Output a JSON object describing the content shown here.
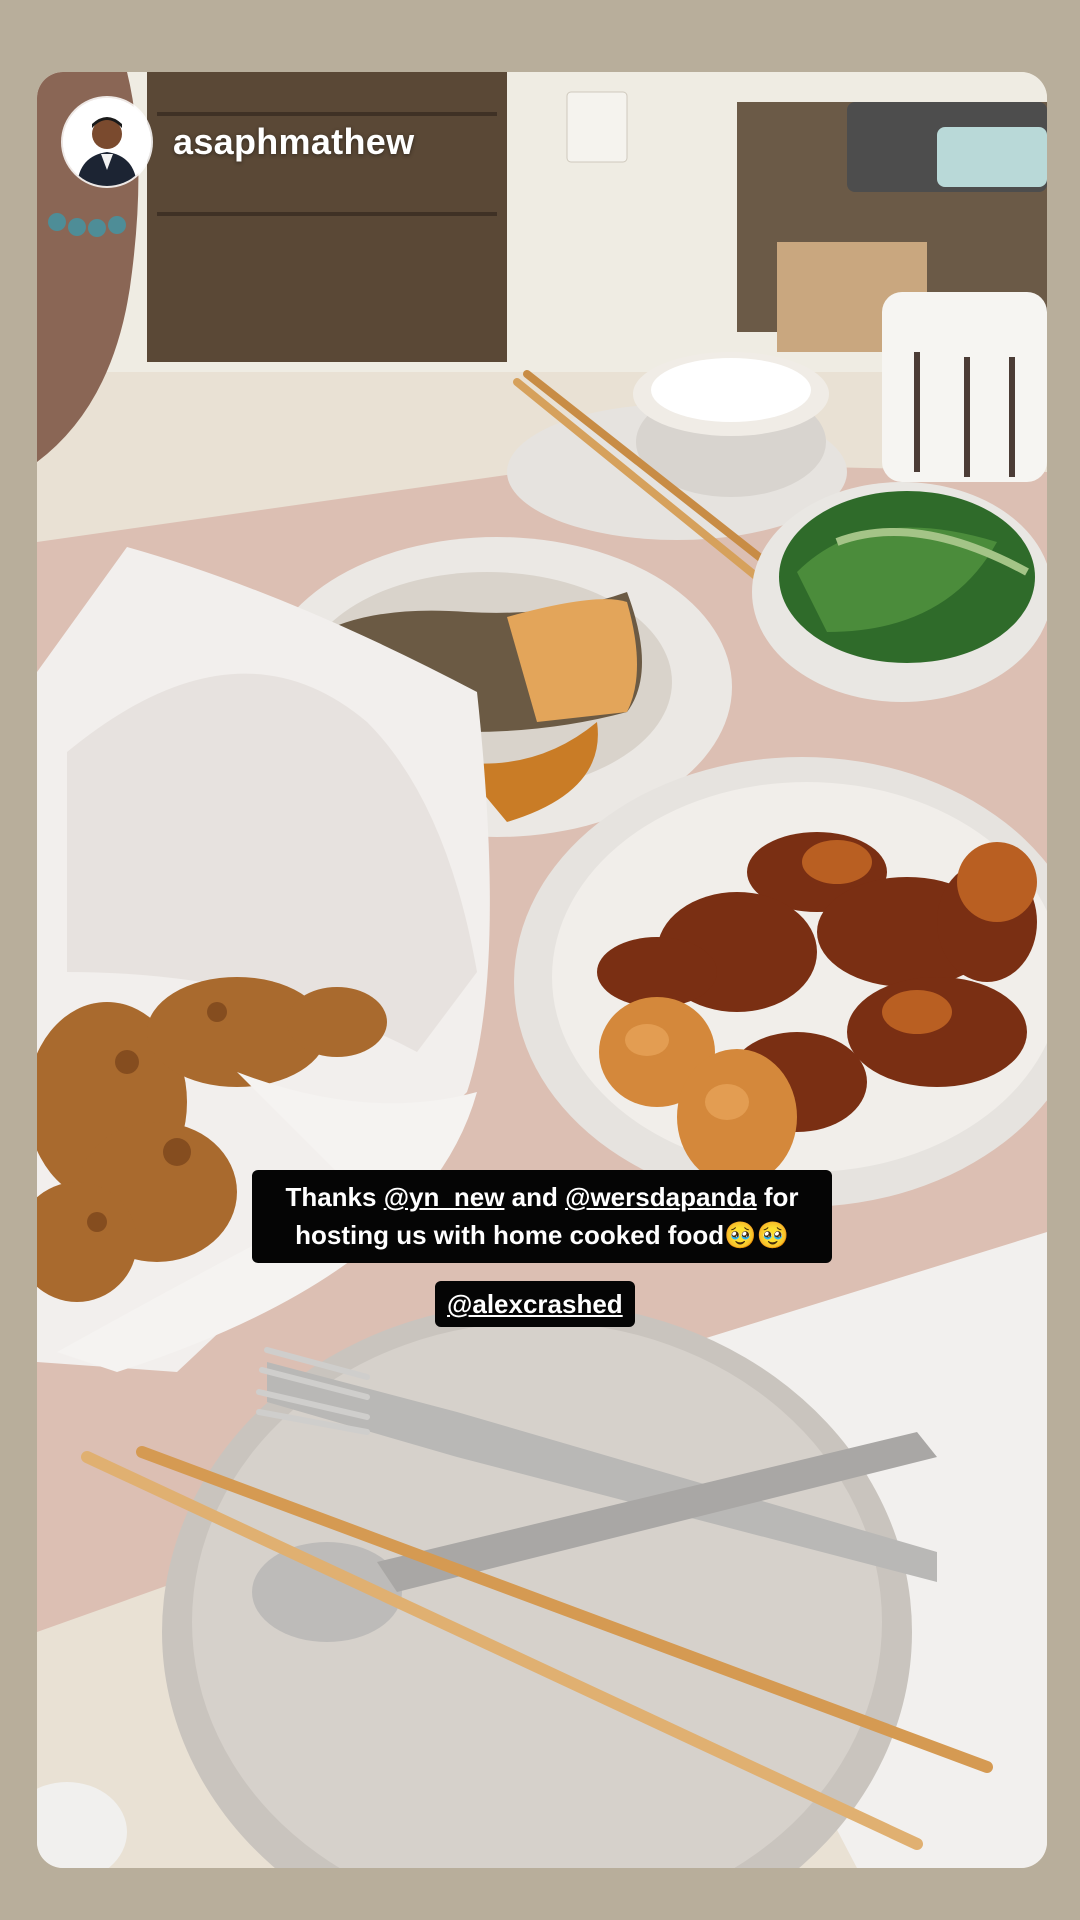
{
  "story": {
    "username": "asaphmathew",
    "caption": {
      "prefix": "Thanks ",
      "mention1": "@yn_new",
      "middle": " and ",
      "mention2": "@wersdapanda",
      "suffix": " for hosting us with home cooked food",
      "emojis": "🥹🥹"
    },
    "tag": "@alexcrashed"
  },
  "colors": {
    "page_background": "#b8ae9b",
    "caption_background": "#050505",
    "caption_text": "#ffffff"
  },
  "icons": {
    "avatar": "profile-avatar"
  }
}
